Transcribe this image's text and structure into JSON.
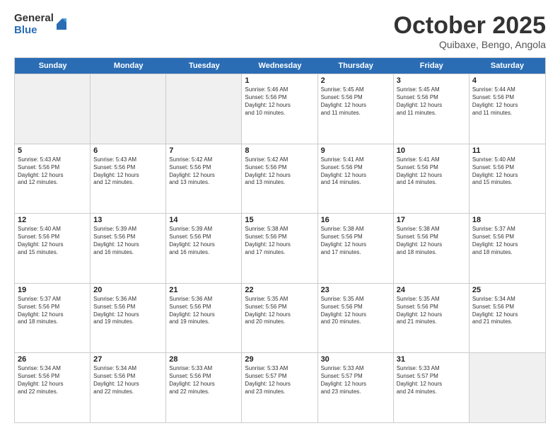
{
  "logo": {
    "general": "General",
    "blue": "Blue"
  },
  "header": {
    "month": "October 2025",
    "location": "Quibaxe, Bengo, Angola"
  },
  "weekdays": [
    "Sunday",
    "Monday",
    "Tuesday",
    "Wednesday",
    "Thursday",
    "Friday",
    "Saturday"
  ],
  "rows": [
    [
      {
        "day": "",
        "info": "",
        "empty": true
      },
      {
        "day": "",
        "info": "",
        "empty": true
      },
      {
        "day": "",
        "info": "",
        "empty": true
      },
      {
        "day": "1",
        "info": "Sunrise: 5:46 AM\nSunset: 5:56 PM\nDaylight: 12 hours\nand 10 minutes."
      },
      {
        "day": "2",
        "info": "Sunrise: 5:45 AM\nSunset: 5:56 PM\nDaylight: 12 hours\nand 11 minutes."
      },
      {
        "day": "3",
        "info": "Sunrise: 5:45 AM\nSunset: 5:56 PM\nDaylight: 12 hours\nand 11 minutes."
      },
      {
        "day": "4",
        "info": "Sunrise: 5:44 AM\nSunset: 5:56 PM\nDaylight: 12 hours\nand 11 minutes."
      }
    ],
    [
      {
        "day": "5",
        "info": "Sunrise: 5:43 AM\nSunset: 5:56 PM\nDaylight: 12 hours\nand 12 minutes."
      },
      {
        "day": "6",
        "info": "Sunrise: 5:43 AM\nSunset: 5:56 PM\nDaylight: 12 hours\nand 12 minutes."
      },
      {
        "day": "7",
        "info": "Sunrise: 5:42 AM\nSunset: 5:56 PM\nDaylight: 12 hours\nand 13 minutes."
      },
      {
        "day": "8",
        "info": "Sunrise: 5:42 AM\nSunset: 5:56 PM\nDaylight: 12 hours\nand 13 minutes."
      },
      {
        "day": "9",
        "info": "Sunrise: 5:41 AM\nSunset: 5:56 PM\nDaylight: 12 hours\nand 14 minutes."
      },
      {
        "day": "10",
        "info": "Sunrise: 5:41 AM\nSunset: 5:56 PM\nDaylight: 12 hours\nand 14 minutes."
      },
      {
        "day": "11",
        "info": "Sunrise: 5:40 AM\nSunset: 5:56 PM\nDaylight: 12 hours\nand 15 minutes."
      }
    ],
    [
      {
        "day": "12",
        "info": "Sunrise: 5:40 AM\nSunset: 5:56 PM\nDaylight: 12 hours\nand 15 minutes."
      },
      {
        "day": "13",
        "info": "Sunrise: 5:39 AM\nSunset: 5:56 PM\nDaylight: 12 hours\nand 16 minutes."
      },
      {
        "day": "14",
        "info": "Sunrise: 5:39 AM\nSunset: 5:56 PM\nDaylight: 12 hours\nand 16 minutes."
      },
      {
        "day": "15",
        "info": "Sunrise: 5:38 AM\nSunset: 5:56 PM\nDaylight: 12 hours\nand 17 minutes."
      },
      {
        "day": "16",
        "info": "Sunrise: 5:38 AM\nSunset: 5:56 PM\nDaylight: 12 hours\nand 17 minutes."
      },
      {
        "day": "17",
        "info": "Sunrise: 5:38 AM\nSunset: 5:56 PM\nDaylight: 12 hours\nand 18 minutes."
      },
      {
        "day": "18",
        "info": "Sunrise: 5:37 AM\nSunset: 5:56 PM\nDaylight: 12 hours\nand 18 minutes."
      }
    ],
    [
      {
        "day": "19",
        "info": "Sunrise: 5:37 AM\nSunset: 5:56 PM\nDaylight: 12 hours\nand 18 minutes."
      },
      {
        "day": "20",
        "info": "Sunrise: 5:36 AM\nSunset: 5:56 PM\nDaylight: 12 hours\nand 19 minutes."
      },
      {
        "day": "21",
        "info": "Sunrise: 5:36 AM\nSunset: 5:56 PM\nDaylight: 12 hours\nand 19 minutes."
      },
      {
        "day": "22",
        "info": "Sunrise: 5:35 AM\nSunset: 5:56 PM\nDaylight: 12 hours\nand 20 minutes."
      },
      {
        "day": "23",
        "info": "Sunrise: 5:35 AM\nSunset: 5:56 PM\nDaylight: 12 hours\nand 20 minutes."
      },
      {
        "day": "24",
        "info": "Sunrise: 5:35 AM\nSunset: 5:56 PM\nDaylight: 12 hours\nand 21 minutes."
      },
      {
        "day": "25",
        "info": "Sunrise: 5:34 AM\nSunset: 5:56 PM\nDaylight: 12 hours\nand 21 minutes."
      }
    ],
    [
      {
        "day": "26",
        "info": "Sunrise: 5:34 AM\nSunset: 5:56 PM\nDaylight: 12 hours\nand 22 minutes."
      },
      {
        "day": "27",
        "info": "Sunrise: 5:34 AM\nSunset: 5:56 PM\nDaylight: 12 hours\nand 22 minutes."
      },
      {
        "day": "28",
        "info": "Sunrise: 5:33 AM\nSunset: 5:56 PM\nDaylight: 12 hours\nand 22 minutes."
      },
      {
        "day": "29",
        "info": "Sunrise: 5:33 AM\nSunset: 5:57 PM\nDaylight: 12 hours\nand 23 minutes."
      },
      {
        "day": "30",
        "info": "Sunrise: 5:33 AM\nSunset: 5:57 PM\nDaylight: 12 hours\nand 23 minutes."
      },
      {
        "day": "31",
        "info": "Sunrise: 5:33 AM\nSunset: 5:57 PM\nDaylight: 12 hours\nand 24 minutes."
      },
      {
        "day": "",
        "info": "",
        "empty": true
      }
    ]
  ]
}
